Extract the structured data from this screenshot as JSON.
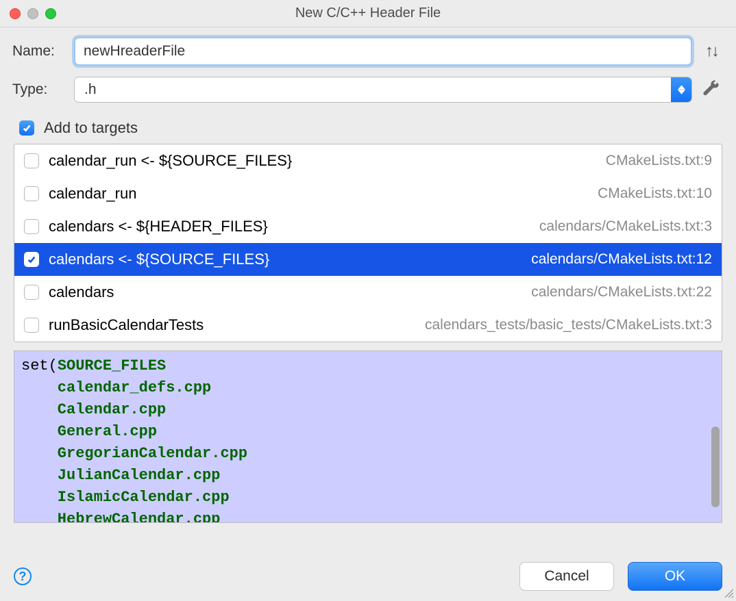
{
  "window_title": "New C/C++ Header File",
  "name_row": {
    "label": "Name:",
    "value": "newHreaderFile"
  },
  "type_row": {
    "label": "Type:",
    "value": ".h"
  },
  "add_targets": {
    "label": "Add to targets",
    "checked": true
  },
  "targets": [
    {
      "label": "calendar_run <- ${SOURCE_FILES}",
      "path": "CMakeLists.txt:9",
      "checked": false,
      "selected": false
    },
    {
      "label": "calendar_run",
      "path": "CMakeLists.txt:10",
      "checked": false,
      "selected": false
    },
    {
      "label": "calendars <- ${HEADER_FILES}",
      "path": "calendars/CMakeLists.txt:3",
      "checked": false,
      "selected": false
    },
    {
      "label": "calendars <- ${SOURCE_FILES}",
      "path": "calendars/CMakeLists.txt:12",
      "checked": true,
      "selected": true
    },
    {
      "label": "calendars",
      "path": "calendars/CMakeLists.txt:22",
      "checked": false,
      "selected": false
    },
    {
      "label": "runBasicCalendarTests",
      "path": "calendars_tests/basic_tests/CMakeLists.txt:3",
      "checked": false,
      "selected": false
    }
  ],
  "code": {
    "keyword": "set",
    "var": "SOURCE_FILES",
    "lines": [
      "calendar_defs.cpp",
      "Calendar.cpp",
      "General.cpp",
      "GregorianCalendar.cpp",
      "JulianCalendar.cpp",
      "IslamicCalendar.cpp",
      "HebrewCalendar.cpp"
    ]
  },
  "buttons": {
    "cancel": "Cancel",
    "ok": "OK"
  },
  "updown_glyph": "↑↓",
  "help_glyph": "?"
}
